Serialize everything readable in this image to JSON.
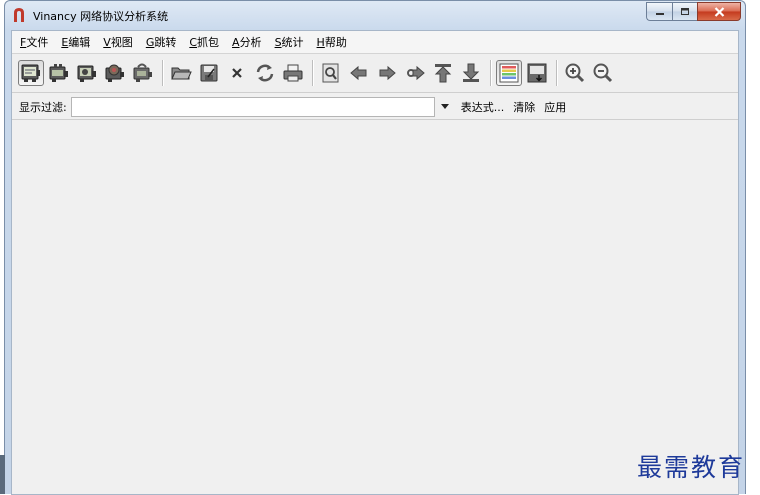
{
  "window": {
    "title": "Vinancy 网络协议分析系统",
    "accent_color": "#c0392b"
  },
  "menu": [
    {
      "mnemonic": "F",
      "label": "文件"
    },
    {
      "mnemonic": "E",
      "label": "编辑"
    },
    {
      "mnemonic": "V",
      "label": "视图"
    },
    {
      "mnemonic": "G",
      "label": "跳转"
    },
    {
      "mnemonic": "C",
      "label": "抓包"
    },
    {
      "mnemonic": "A",
      "label": "分析"
    },
    {
      "mnemonic": "S",
      "label": "统计"
    },
    {
      "mnemonic": "H",
      "label": "帮助"
    }
  ],
  "toolbar": {
    "icons": [
      "capture-interfaces-icon",
      "capture-options-icon",
      "capture-start-icon",
      "capture-stop-icon",
      "capture-restart-icon",
      "open-file-icon",
      "save-file-icon",
      "close-file-icon",
      "reload-icon",
      "print-icon",
      "find-packet-icon",
      "go-back-icon",
      "go-forward-icon",
      "go-to-packet-icon",
      "go-first-icon",
      "go-last-icon",
      "colorize-icon",
      "auto-scroll-icon",
      "zoom-in-icon",
      "zoom-out-icon"
    ],
    "pressed": [
      "colorize-icon"
    ]
  },
  "filter": {
    "label": "显示过滤:",
    "value": "",
    "expression_label": "表达式...",
    "clear_label": "清除",
    "apply_label": "应用"
  },
  "watermark": {
    "text": "最需教育"
  }
}
